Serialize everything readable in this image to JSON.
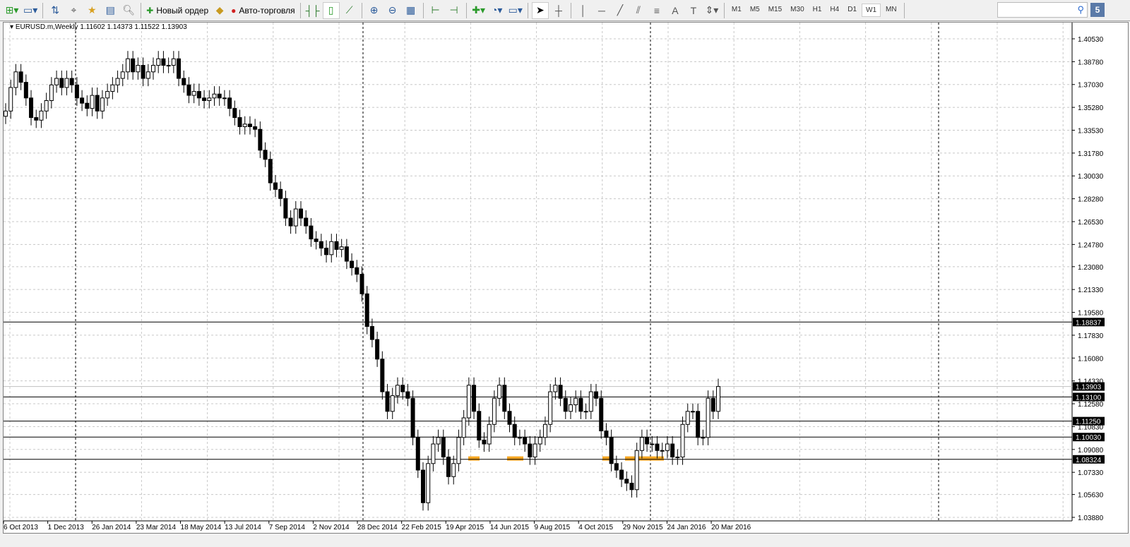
{
  "toolbar": {
    "new_order": "Новый ордер",
    "auto_trading": "Авто-торговля",
    "timeframes": [
      "M1",
      "M5",
      "M15",
      "M30",
      "H1",
      "H4",
      "D1",
      "W1",
      "MN"
    ],
    "active_timeframe": "W1",
    "chat_badge": "5"
  },
  "chart": {
    "symbol": "EURUSD.m,Weekly",
    "ohlc": "1.11602 1.14373 1.11522 1.13903",
    "price_ticks": [
      "1.40530",
      "1.38780",
      "1.37030",
      "1.35280",
      "1.33530",
      "1.31780",
      "1.30030",
      "1.28280",
      "1.26530",
      "1.24780",
      "1.23080",
      "1.21330",
      "1.19580",
      "1.17830",
      "1.16080",
      "1.14330",
      "1.12580",
      "1.10830",
      "1.09080",
      "1.07330",
      "1.05630",
      "1.03880"
    ],
    "levels": [
      "1.18837",
      "1.13100",
      "1.11250",
      "1.10030",
      "1.08324"
    ],
    "bid": "1.13903",
    "time_labels": [
      "6 Oct 2013",
      "1 Dec 2013",
      "26 Jan 2014",
      "23 Mar 2014",
      "18 May 2014",
      "13 Jul 2014",
      "7 Sep 2014",
      "2 Nov 2014",
      "28 Dec 2014",
      "22 Feb 2015",
      "19 Apr 2015",
      "14 Jun 2015",
      "9 Aug 2015",
      "4 Oct 2015",
      "29 Nov 2015",
      "24 Jan 2016",
      "20 Mar 2016"
    ],
    "colors": {
      "level_line": "#000000",
      "bid_line": "#c0c0c0",
      "zone": "#f5a623"
    },
    "closes": [
      1.35,
      1.368,
      1.38,
      1.372,
      1.36,
      1.345,
      1.343,
      1.35,
      1.358,
      1.37,
      1.375,
      1.368,
      1.375,
      1.37,
      1.36,
      1.356,
      1.352,
      1.362,
      1.35,
      1.36,
      1.365,
      1.37,
      1.375,
      1.38,
      1.39,
      1.38,
      1.385,
      1.375,
      1.38,
      1.385,
      1.39,
      1.385,
      1.385,
      1.39,
      1.375,
      1.37,
      1.362,
      1.365,
      1.36,
      1.358,
      1.36,
      1.363,
      1.36,
      1.36,
      1.352,
      1.345,
      1.338,
      1.34,
      1.338,
      1.336,
      1.32,
      1.313,
      1.295,
      1.29,
      1.283,
      1.268,
      1.262,
      1.275,
      1.268,
      1.262,
      1.252,
      1.25,
      1.245,
      1.24,
      1.25,
      1.244,
      1.246,
      1.235,
      1.23,
      1.225,
      1.21,
      1.185,
      1.175,
      1.16,
      1.135,
      1.12,
      1.132,
      1.14,
      1.135,
      1.13,
      1.1,
      1.075,
      1.05,
      1.08,
      1.095,
      1.1,
      1.085,
      1.07,
      1.08,
      1.1,
      1.115,
      1.14,
      1.12,
      1.098,
      1.095,
      1.11,
      1.13,
      1.14,
      1.12,
      1.11,
      1.1,
      1.1,
      1.095,
      1.085,
      1.095,
      1.1,
      1.11,
      1.135,
      1.14,
      1.13,
      1.12,
      1.125,
      1.13,
      1.12,
      1.12,
      1.135,
      1.13,
      1.105,
      1.1,
      1.08,
      1.075,
      1.068,
      1.065,
      1.06,
      1.09,
      1.1,
      1.095,
      1.095,
      1.09,
      1.09,
      1.095,
      1.085,
      1.085,
      1.11,
      1.12,
      1.12,
      1.1,
      1.1,
      1.13,
      1.12,
      1.139
    ]
  }
}
